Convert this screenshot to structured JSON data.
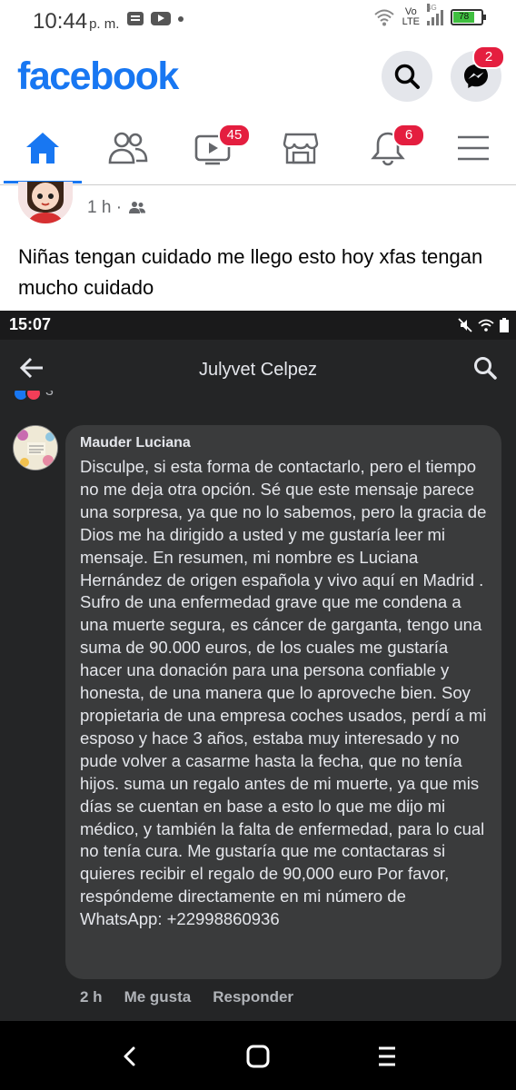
{
  "status_bar": {
    "time": "10:44",
    "ampm": "p. m.",
    "volte_top": "Vo",
    "volte_bottom": "LTE",
    "network": "4G",
    "battery": "78"
  },
  "header": {
    "logo": "facebook",
    "messenger_badge": "2"
  },
  "nav": {
    "tabs": [
      {
        "name": "home",
        "icon": "home-icon",
        "active": true
      },
      {
        "name": "friends",
        "icon": "friends-icon"
      },
      {
        "name": "watch",
        "icon": "video-icon",
        "badge": "45"
      },
      {
        "name": "marketplace",
        "icon": "marketplace-icon"
      },
      {
        "name": "notifications",
        "icon": "bell-icon",
        "badge": "6"
      },
      {
        "name": "menu",
        "icon": "menu-icon"
      }
    ]
  },
  "post": {
    "time": "1 h ·",
    "text": "Niñas tengan cuidado me llego esto hoy  xfas tengan mucho cuidado"
  },
  "screenshot": {
    "status_time": "15:07",
    "title": "Julyvet Celpez",
    "reaction_count": "3",
    "comment": {
      "author": "Mauder Luciana",
      "text": "Disculpe, si esta forma de contactarlo, pero el tiempo no me deja otra opción.  Sé que este mensaje parece una sorpresa, ya que no lo sabemos, pero la gracia de Dios me ha dirigido a usted y me gustaría leer mi mensaje. En resumen, mi nombre es Luciana Hernández de origen española y vivo  aquí en Madrid .  Sufro de una enfermedad grave que me condena a una muerte segura, es cáncer de garganta, tengo una suma de 90.000 euros, de los cuales me gustaría hacer una donación para una persona confiable y honesta, de una manera que lo aproveche bien.  Soy propietaria de una empresa  coches usados, perdí a mi esposo y hace 3 años, estaba muy interesado y no pude volver a casarme hasta la fecha, que no tenía hijos.  suma un regalo antes de mi muerte, ya que mis días se cuentan en base a esto lo que me dijo mi médico, y también la falta de enfermedad, para lo cual no tenía cura.  Me gustaría que me contactaras si quieres recibir el regalo de 90,000 euro Por favor, respóndeme directamente en mi número de WhatsApp: +22998860936",
      "time": "2 h",
      "like": "Me gusta",
      "reply": "Responder"
    }
  },
  "colors": {
    "brand": "#1877f2",
    "badge": "#e41e3f",
    "dark_bg": "#242526",
    "bubble": "#3a3b3c"
  }
}
